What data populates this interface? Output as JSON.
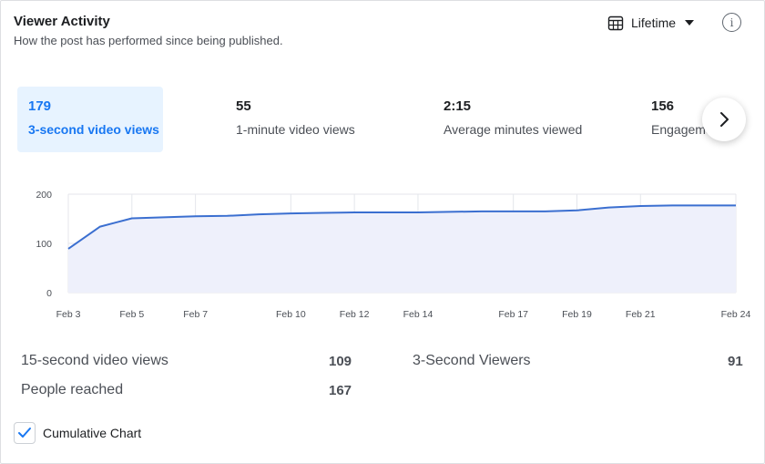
{
  "header": {
    "title": "Viewer Activity",
    "subtitle": "How the post has performed since being published.",
    "range_label": "Lifetime",
    "calendar_icon": "calendar-icon",
    "info_icon": "info-icon"
  },
  "metrics": [
    {
      "value": "179",
      "label": "3-second video views",
      "active": true
    },
    {
      "value": "55",
      "label": "1-minute video views",
      "active": false
    },
    {
      "value": "2:15",
      "label": "Average minutes viewed",
      "active": false
    },
    {
      "value": "156",
      "label": "Engagements",
      "active": false
    }
  ],
  "colors": {
    "accent": "#1877f2",
    "active_bg": "#e7f3ff",
    "line": "#3b6fd0",
    "area": "#eef0fb",
    "grid": "#e4e6eb"
  },
  "chart_data": {
    "type": "area",
    "x": [
      "Feb 3",
      "Feb 4",
      "Feb 5",
      "Feb 6",
      "Feb 7",
      "Feb 8",
      "Feb 9",
      "Feb 10",
      "Feb 11",
      "Feb 12",
      "Feb 13",
      "Feb 14",
      "Feb 15",
      "Feb 16",
      "Feb 17",
      "Feb 18",
      "Feb 19",
      "Feb 20",
      "Feb 21",
      "Feb 22",
      "Feb 23",
      "Feb 24"
    ],
    "series": [
      {
        "values": [
          89,
          134,
          151,
          153,
          155,
          156,
          159,
          161,
          162,
          163,
          163,
          163,
          164,
          165,
          165,
          165,
          167,
          173,
          176,
          177,
          177,
          177
        ]
      }
    ],
    "xticks": [
      "Feb 3",
      "Feb 5",
      "Feb 7",
      "Feb 10",
      "Feb 12",
      "Feb 14",
      "Feb 17",
      "Feb 19",
      "Feb 21",
      "Feb 24"
    ],
    "yticks": [
      "200",
      "100",
      "0"
    ],
    "ylim": [
      0,
      200
    ],
    "grid": true
  },
  "stats": [
    {
      "label": "15-second video views",
      "value": "109"
    },
    {
      "label": "3-Second Viewers",
      "value": "91"
    },
    {
      "label": "People reached",
      "value": "167"
    }
  ],
  "cumulative": {
    "label": "Cumulative Chart",
    "checked": true
  }
}
